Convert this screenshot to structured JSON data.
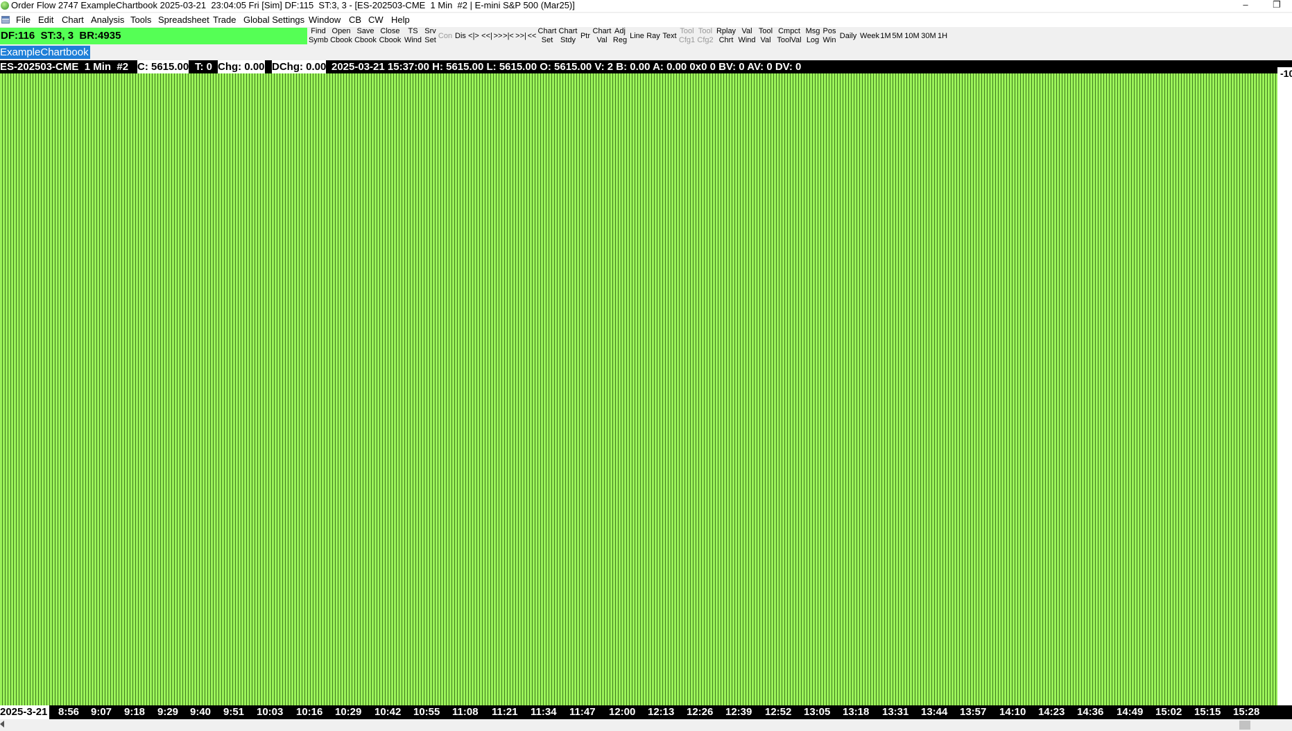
{
  "window": {
    "title": "Order Flow 2747 ExampleChartbook 2025-03-21  23:04:05 Fri [Sim] DF:115  ST:3, 3 - [ES-202503-CME  1 Min  #2 | E-mini S&P 500 (Mar25)]",
    "minimize_glyph": "–",
    "restore_glyph": "❐"
  },
  "menu": [
    "File",
    "Edit",
    "Chart",
    "Analysis",
    "Tools",
    "Spreadsheet",
    "Trade",
    "Global Settings",
    "Window",
    "CB",
    "CW",
    "Help"
  ],
  "status": {
    "text": "DF:116  ST:3, 3  BR:4935",
    "color": "#55ff55"
  },
  "toolbar": [
    {
      "label": "Find\nSymb",
      "enabled": true
    },
    {
      "label": "Open\nCbook",
      "enabled": true
    },
    {
      "label": "Save\nCbook",
      "enabled": true
    },
    {
      "label": "Close\nCbook",
      "enabled": true
    },
    {
      "label": "TS\nWind",
      "enabled": true
    },
    {
      "label": "Srv\nSet",
      "enabled": true
    },
    {
      "label": "Con",
      "enabled": false
    },
    {
      "label": "Dis",
      "enabled": true
    },
    {
      "label": "<|>",
      "enabled": true
    },
    {
      "label": "<<|",
      "enabled": true
    },
    {
      "label": ">>",
      "enabled": true
    },
    {
      "label": ">|<",
      "enabled": true
    },
    {
      "label": ">>|",
      "enabled": true
    },
    {
      "label": "<<",
      "enabled": true
    },
    {
      "label": "Chart\nSet",
      "enabled": true
    },
    {
      "label": "Chart\nStdy",
      "enabled": true
    },
    {
      "label": "Ptr",
      "enabled": true
    },
    {
      "label": "Chart\nVal",
      "enabled": true
    },
    {
      "label": "Adj\nReg",
      "enabled": true
    },
    {
      "label": "Line",
      "enabled": true
    },
    {
      "label": "Ray",
      "enabled": true
    },
    {
      "label": "Text",
      "enabled": true
    },
    {
      "label": "Tool\nCfg1",
      "enabled": false
    },
    {
      "label": "Tool\nCfg2",
      "enabled": false
    },
    {
      "label": "Rplay\nChrt",
      "enabled": true
    },
    {
      "label": "Val\nWind",
      "enabled": true
    },
    {
      "label": "Tool\nVal",
      "enabled": true
    },
    {
      "label": "Cmpct\nToolVal",
      "enabled": true
    },
    {
      "label": "Msg\nLog",
      "enabled": true
    },
    {
      "label": "Pos\nWin",
      "enabled": true
    },
    {
      "label": "Daily",
      "enabled": true
    },
    {
      "label": "Week",
      "enabled": true
    },
    {
      "label": "1M",
      "enabled": true
    },
    {
      "label": "5M",
      "enabled": true
    },
    {
      "label": "10M",
      "enabled": true
    },
    {
      "label": "30M",
      "enabled": true
    },
    {
      "label": "1H",
      "enabled": true
    }
  ],
  "chartbook_tab": "ExampleChartbook",
  "infobar": {
    "symbol": "ES-202503-CME  1 Min  #2",
    "close": "C: 5615.00",
    "t": "T: 0",
    "chg": "Chg: 0.00",
    "dchg": "DChg: 0.00",
    "details": "2025-03-21 15:37:00 H: 5615.00 L: 5615.00 O: 5615.00 V: 2 B: 0.00 A: 0.00 0x0 0 BV: 0 AV: 0 DV: 0"
  },
  "price_scale_label": "-10",
  "chart_colors": {
    "bar_fill": "#9cf45a",
    "bar_edge": "#3e7a1e"
  },
  "time_axis": {
    "date": "2025-3-21",
    "labels": [
      "8:56",
      "9:07",
      "9:18",
      "9:29",
      "9:40",
      "9:51",
      "10:03",
      "10:16",
      "10:29",
      "10:42",
      "10:55",
      "11:08",
      "11:21",
      "11:34",
      "11:47",
      "12:00",
      "12:13",
      "12:26",
      "12:39",
      "12:52",
      "13:05",
      "13:18",
      "13:31",
      "13:44",
      "13:57",
      "14:10",
      "14:23",
      "14:36",
      "14:49",
      "15:02",
      "15:15",
      "15:28"
    ]
  }
}
